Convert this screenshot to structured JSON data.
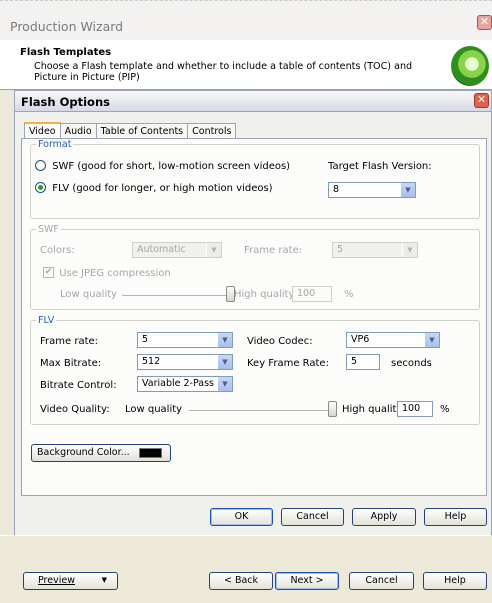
{
  "wizard": {
    "title": "Production Wizard",
    "close_glyph": "✕",
    "header_title": "Flash Templates",
    "header_desc": "Choose a Flash template and whether to include a table of contents (TOC) and Picture in Picture (PIP)",
    "logo_icon": "green-orb-logo-icon"
  },
  "dialog": {
    "title": "Flash Options",
    "close_glyph": "✕",
    "tabs": [
      {
        "label": "Video",
        "active": true
      },
      {
        "label": "Audio",
        "active": false
      },
      {
        "label": "Table of Contents",
        "active": false
      },
      {
        "label": "Controls",
        "active": false
      }
    ],
    "format": {
      "legend": "Format",
      "swf_label": "SWF (good for short, low-motion screen videos)",
      "flv_label": "FLV (good for longer, or high motion videos)",
      "selected": "FLV",
      "target_label": "Target Flash Version:",
      "target_value": "8"
    },
    "swf": {
      "legend": "SWF",
      "colors_label": "Colors:",
      "colors_value": "Automatic",
      "frame_rate_label": "Frame rate:",
      "frame_rate_value": "5",
      "jpeg_label": "Use JPEG compression",
      "jpeg_checked": true,
      "low_label": "Low quality",
      "high_label": "High quality",
      "quality_value": "100",
      "quality_fraction": 1.0,
      "percent": "%"
    },
    "flv": {
      "legend": "FLV",
      "frame_rate_label": "Frame rate:",
      "frame_rate_value": "5",
      "max_bitrate_label": "Max Bitrate:",
      "max_bitrate_value": "512",
      "bitrate_control_label": "Bitrate Control:",
      "bitrate_control_value": "Variable 2-Pass",
      "codec_label": "Video Codec:",
      "codec_value": "VP6",
      "key_frame_label": "Key Frame Rate:",
      "key_frame_value": "5",
      "seconds_label": "seconds",
      "video_quality_label": "Video Quality:",
      "low_label": "Low quality",
      "high_label": "High quality",
      "quality_value": "100",
      "quality_fraction": 1.0,
      "percent": "%"
    },
    "background_color_label": "Background Color...",
    "background_color": "#000000",
    "buttons": {
      "ok": "OK",
      "cancel": "Cancel",
      "apply": "Apply",
      "help": "Help"
    }
  },
  "footer": {
    "preview": "Preview",
    "back": "< Back",
    "next": "Next >",
    "cancel": "Cancel",
    "help": "Help"
  }
}
